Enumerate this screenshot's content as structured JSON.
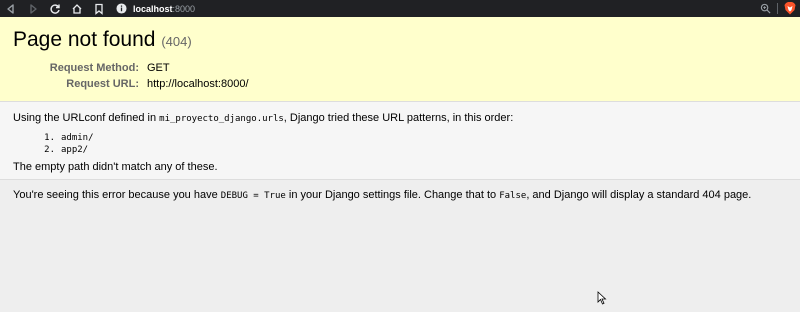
{
  "browser": {
    "url_host": "localhost",
    "url_port": ":8000",
    "icons": [
      "back-icon",
      "forward-icon",
      "reload-icon",
      "home-icon",
      "bookmark-icon",
      "info-icon",
      "zoom-icon",
      "brave-icon"
    ]
  },
  "summary": {
    "title": "Page not found",
    "status_code": "(404)",
    "request_method_label": "Request Method:",
    "request_method": "GET",
    "request_url_label": "Request URL:",
    "request_url": "http://localhost:8000/"
  },
  "info": {
    "intro_before": "Using the URLconf defined in ",
    "urlconf": "mi_proyecto_django.urls",
    "intro_after": ", Django tried these URL patterns, in this order:",
    "patterns": [
      {
        "num": "1.",
        "pattern": "admin/"
      },
      {
        "num": "2.",
        "pattern": "app2/"
      }
    ],
    "no_match": "The empty path didn't match any of these."
  },
  "explanation": {
    "part1": "You're seeing this error because you have ",
    "debug_code": "DEBUG = True",
    "part2": " in your Django settings file. Change that to ",
    "false_code": "False",
    "part3": ", and Django will display a standard 404 page."
  },
  "colors": {
    "summary_bg": "#ffffcc",
    "info_bg": "#f6f6f6",
    "page_bg": "#eeeeee",
    "chrome_bg": "#202124",
    "brave_orange": "#fb542b"
  }
}
